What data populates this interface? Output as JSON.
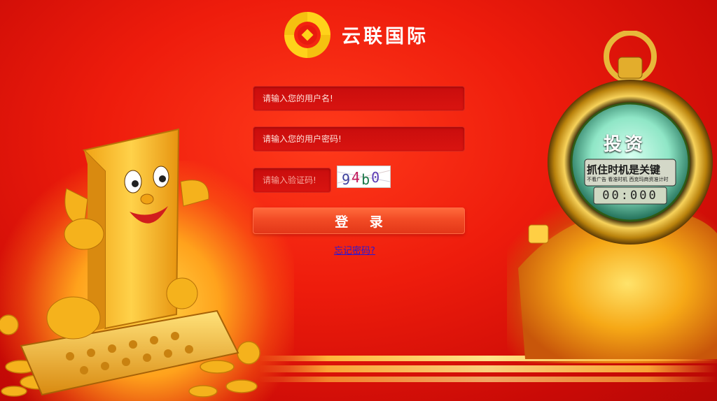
{
  "brand": {
    "name": "云联国际",
    "logo_colors": {
      "outer": "#ffd21a",
      "inner": "#e8c000"
    }
  },
  "form": {
    "username_placeholder": "请输入您的用户名!",
    "password_placeholder": "请输入您的用户密码!",
    "captcha_placeholder": "请输入验证码!",
    "captcha_text": "94b0",
    "login_label": "登 录",
    "forgot_label": "忘记密码?"
  },
  "promo": {
    "watch_title": "投资",
    "watch_slogan": "抓住时机是关键",
    "watch_subtitle": "不看广告 看准时机 西克玛商资准计时",
    "watch_timer": "00:000"
  },
  "theme": {
    "background": "#e81a0e",
    "accent_gold": "#ffc21e",
    "link_color": "#2a18d6"
  }
}
